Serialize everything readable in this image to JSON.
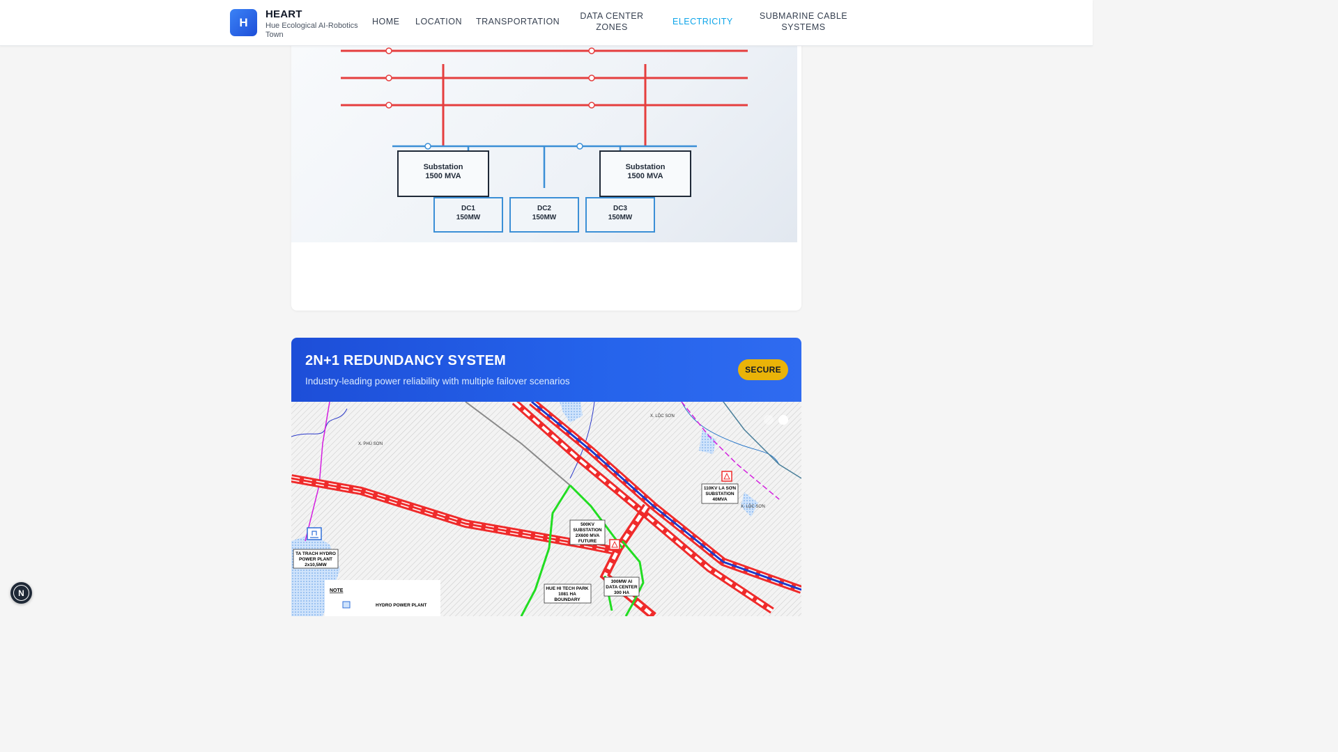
{
  "header": {
    "logo_letter": "H",
    "title": "HEART",
    "subtitle": "Hue Ecological AI-Robotics Town",
    "nav": [
      {
        "label": "HOME",
        "active": false
      },
      {
        "label": "LOCATION",
        "active": false
      },
      {
        "label": "TRANSPORTATION",
        "active": false
      },
      {
        "label": "DATA CENTER ZONES",
        "active": false
      },
      {
        "label": "ELECTRICITY",
        "active": true
      },
      {
        "label": "SUBMARINE CABLE SYSTEMS",
        "active": false
      }
    ]
  },
  "diagram": {
    "substations": [
      {
        "name": "Substation",
        "capacity": "1500 MVA"
      },
      {
        "name": "Substation",
        "capacity": "1500 MVA"
      }
    ],
    "data_centers": [
      {
        "name": "DC1",
        "power": "150MW"
      },
      {
        "name": "DC2",
        "power": "150MW"
      },
      {
        "name": "DC3",
        "power": "150MW"
      }
    ],
    "colors": {
      "transmission": "#e53e3e",
      "distribution": "#3b8fd6",
      "box_border": "#1f2937",
      "dc_border": "#3b8fd6"
    }
  },
  "redundancy": {
    "title": "2N+1 REDUNDANCY SYSTEM",
    "subtitle": "Industry-leading power reliability with multiple failover scenarios",
    "badge": "SECURE",
    "badge_color": "#eab308",
    "map_labels": {
      "loc_son": "X. LỘC SƠN",
      "phu_son": "X. PHÚ SƠN",
      "loc_son_lower": "X. LỘC SƠN",
      "la_son_substation": [
        "110KV LA SƠN",
        "SUBSTATION",
        "40MVA"
      ],
      "substation_500kv": [
        "500KV",
        "SUBSTATION",
        "2X600 MVA",
        "FUTURE"
      ],
      "ta_trach": [
        "TA TRACH HYDRO",
        "POWER PLANT",
        "2x10,5MW"
      ],
      "hi_tech_park": [
        "HUE HI TECH PARK",
        "1081 HA",
        "BOUNDARY"
      ],
      "data_center": [
        "300MW AI",
        "DATA CENTER",
        "300 HA"
      ],
      "note_title": "NOTE",
      "note_item": "HYDRO POWER PLANT"
    },
    "carousel": {
      "total": 2,
      "active_index": 1
    }
  },
  "floating_button": {
    "label": "N"
  }
}
